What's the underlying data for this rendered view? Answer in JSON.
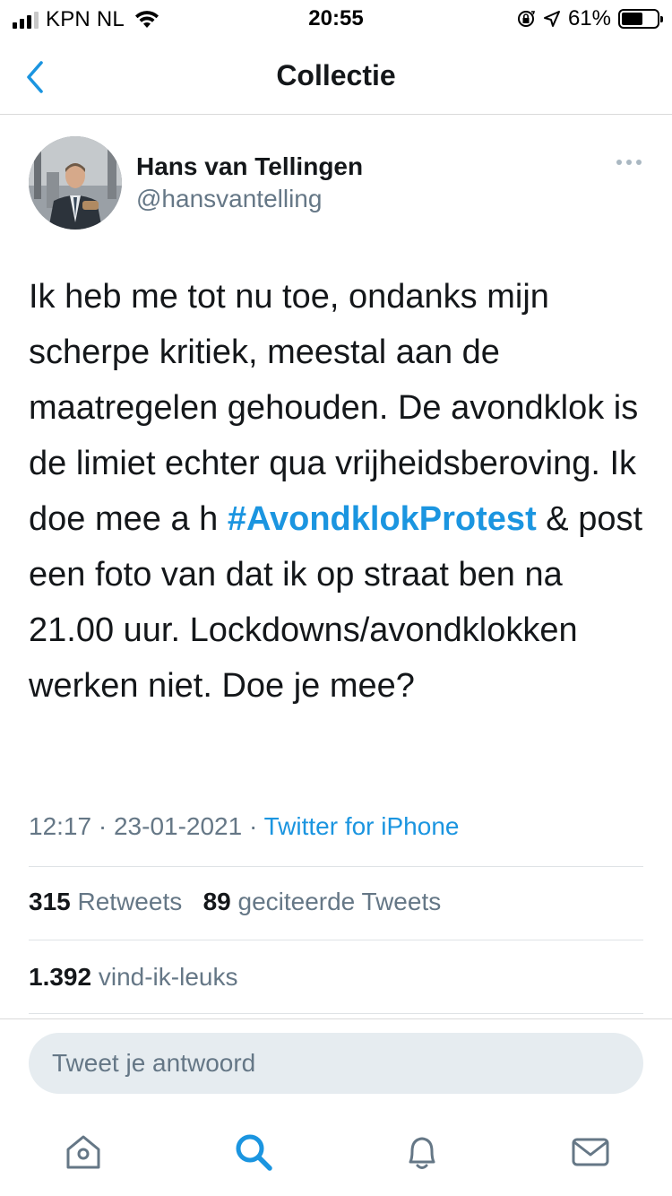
{
  "status_bar": {
    "carrier": "KPN NL",
    "time": "20:55",
    "battery_percent": "61%",
    "battery_level": 0.61
  },
  "nav": {
    "title": "Collectie",
    "back_icon": "chevron-left-icon"
  },
  "tweet": {
    "author_name": "Hans van Tellingen",
    "author_handle": "@hansvantelling",
    "text_before": "Ik heb me tot nu toe, ondanks mijn scherpe kritiek, meestal aan de maatregelen gehouden. De avondklok is de limiet echter qua vrijheidsberoving. Ik doe mee a h ",
    "hashtag": "#AvondklokProtest",
    "text_after": " & post een foto van dat ik op straat ben na 21.00 uur. Lockdowns/avondklokken werken niet. Doe je mee?",
    "time": "12:17",
    "date": "23-01-2021",
    "separator": "·",
    "source": "Twitter for iPhone"
  },
  "stats": {
    "retweets_count": "315",
    "retweets_label": "Retweets",
    "quotes_count": "89",
    "quotes_label": "geciteerde Tweets",
    "likes_count": "1.392",
    "likes_label": "vind-ik-leuks"
  },
  "reply": {
    "placeholder": "Tweet je antwoord"
  },
  "tabs": [
    {
      "name": "home",
      "icon": "home-icon"
    },
    {
      "name": "search",
      "icon": "search-icon",
      "active": true
    },
    {
      "name": "notifications",
      "icon": "bell-icon"
    },
    {
      "name": "messages",
      "icon": "mail-icon"
    }
  ],
  "colors": {
    "accent": "#1b95e0",
    "secondary_text": "#657786",
    "primary_text": "#14171a"
  }
}
